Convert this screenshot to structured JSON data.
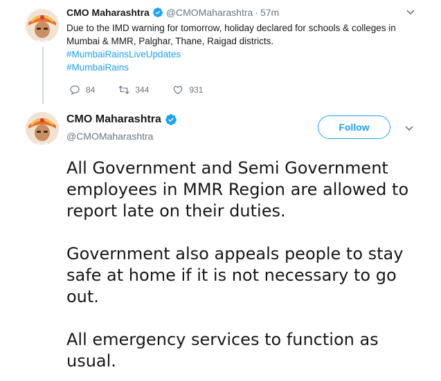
{
  "tweet1": {
    "name": "CMO Maharashtra",
    "handle": "@CMOMaharashtra",
    "separator": "·",
    "time": "57m",
    "text": "Due to the IMD warning for tomorrow, holiday declared for schools & colleges in Mumbai & MMR, Palghar, Thane, Raigad districts.",
    "hashtags": [
      "#MumbaiRainsLiveUpdates",
      "#MumbaiRains"
    ],
    "reply_count": "84",
    "retweet_count": "344",
    "like_count": "931"
  },
  "tweet2": {
    "name": "CMO Maharashtra",
    "handle": "@CMOMaharashtra",
    "follow_label": "Follow",
    "paragraphs": [
      "All Government and Semi Government employees in MMR Region are allowed to report late on their duties.",
      "Government also appeals people to stay safe at home if it is not necessary to go out.",
      "All emergency services to function as usual."
    ]
  },
  "colors": {
    "accent": "#1da1f2",
    "secondary_text": "#657786",
    "primary_text": "#14171a",
    "thread_line": "#ccd6dd"
  },
  "icons": [
    "verified-badge-icon",
    "chevron-down-icon",
    "reply-icon",
    "retweet-icon",
    "like-icon"
  ]
}
